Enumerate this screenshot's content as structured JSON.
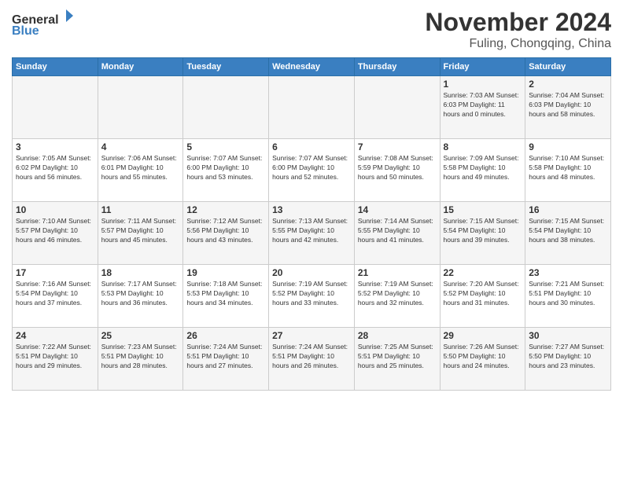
{
  "logo": {
    "general": "General",
    "blue": "Blue"
  },
  "header": {
    "month": "November 2024",
    "location": "Fuling, Chongqing, China"
  },
  "weekdays": [
    "Sunday",
    "Monday",
    "Tuesday",
    "Wednesday",
    "Thursday",
    "Friday",
    "Saturday"
  ],
  "weeks": [
    [
      {
        "day": "",
        "info": ""
      },
      {
        "day": "",
        "info": ""
      },
      {
        "day": "",
        "info": ""
      },
      {
        "day": "",
        "info": ""
      },
      {
        "day": "",
        "info": ""
      },
      {
        "day": "1",
        "info": "Sunrise: 7:03 AM\nSunset: 6:03 PM\nDaylight: 11 hours and 0 minutes."
      },
      {
        "day": "2",
        "info": "Sunrise: 7:04 AM\nSunset: 6:03 PM\nDaylight: 10 hours and 58 minutes."
      }
    ],
    [
      {
        "day": "3",
        "info": "Sunrise: 7:05 AM\nSunset: 6:02 PM\nDaylight: 10 hours and 56 minutes."
      },
      {
        "day": "4",
        "info": "Sunrise: 7:06 AM\nSunset: 6:01 PM\nDaylight: 10 hours and 55 minutes."
      },
      {
        "day": "5",
        "info": "Sunrise: 7:07 AM\nSunset: 6:00 PM\nDaylight: 10 hours and 53 minutes."
      },
      {
        "day": "6",
        "info": "Sunrise: 7:07 AM\nSunset: 6:00 PM\nDaylight: 10 hours and 52 minutes."
      },
      {
        "day": "7",
        "info": "Sunrise: 7:08 AM\nSunset: 5:59 PM\nDaylight: 10 hours and 50 minutes."
      },
      {
        "day": "8",
        "info": "Sunrise: 7:09 AM\nSunset: 5:58 PM\nDaylight: 10 hours and 49 minutes."
      },
      {
        "day": "9",
        "info": "Sunrise: 7:10 AM\nSunset: 5:58 PM\nDaylight: 10 hours and 48 minutes."
      }
    ],
    [
      {
        "day": "10",
        "info": "Sunrise: 7:10 AM\nSunset: 5:57 PM\nDaylight: 10 hours and 46 minutes."
      },
      {
        "day": "11",
        "info": "Sunrise: 7:11 AM\nSunset: 5:57 PM\nDaylight: 10 hours and 45 minutes."
      },
      {
        "day": "12",
        "info": "Sunrise: 7:12 AM\nSunset: 5:56 PM\nDaylight: 10 hours and 43 minutes."
      },
      {
        "day": "13",
        "info": "Sunrise: 7:13 AM\nSunset: 5:55 PM\nDaylight: 10 hours and 42 minutes."
      },
      {
        "day": "14",
        "info": "Sunrise: 7:14 AM\nSunset: 5:55 PM\nDaylight: 10 hours and 41 minutes."
      },
      {
        "day": "15",
        "info": "Sunrise: 7:15 AM\nSunset: 5:54 PM\nDaylight: 10 hours and 39 minutes."
      },
      {
        "day": "16",
        "info": "Sunrise: 7:15 AM\nSunset: 5:54 PM\nDaylight: 10 hours and 38 minutes."
      }
    ],
    [
      {
        "day": "17",
        "info": "Sunrise: 7:16 AM\nSunset: 5:54 PM\nDaylight: 10 hours and 37 minutes."
      },
      {
        "day": "18",
        "info": "Sunrise: 7:17 AM\nSunset: 5:53 PM\nDaylight: 10 hours and 36 minutes."
      },
      {
        "day": "19",
        "info": "Sunrise: 7:18 AM\nSunset: 5:53 PM\nDaylight: 10 hours and 34 minutes."
      },
      {
        "day": "20",
        "info": "Sunrise: 7:19 AM\nSunset: 5:52 PM\nDaylight: 10 hours and 33 minutes."
      },
      {
        "day": "21",
        "info": "Sunrise: 7:19 AM\nSunset: 5:52 PM\nDaylight: 10 hours and 32 minutes."
      },
      {
        "day": "22",
        "info": "Sunrise: 7:20 AM\nSunset: 5:52 PM\nDaylight: 10 hours and 31 minutes."
      },
      {
        "day": "23",
        "info": "Sunrise: 7:21 AM\nSunset: 5:51 PM\nDaylight: 10 hours and 30 minutes."
      }
    ],
    [
      {
        "day": "24",
        "info": "Sunrise: 7:22 AM\nSunset: 5:51 PM\nDaylight: 10 hours and 29 minutes."
      },
      {
        "day": "25",
        "info": "Sunrise: 7:23 AM\nSunset: 5:51 PM\nDaylight: 10 hours and 28 minutes."
      },
      {
        "day": "26",
        "info": "Sunrise: 7:24 AM\nSunset: 5:51 PM\nDaylight: 10 hours and 27 minutes."
      },
      {
        "day": "27",
        "info": "Sunrise: 7:24 AM\nSunset: 5:51 PM\nDaylight: 10 hours and 26 minutes."
      },
      {
        "day": "28",
        "info": "Sunrise: 7:25 AM\nSunset: 5:51 PM\nDaylight: 10 hours and 25 minutes."
      },
      {
        "day": "29",
        "info": "Sunrise: 7:26 AM\nSunset: 5:50 PM\nDaylight: 10 hours and 24 minutes."
      },
      {
        "day": "30",
        "info": "Sunrise: 7:27 AM\nSunset: 5:50 PM\nDaylight: 10 hours and 23 minutes."
      }
    ]
  ]
}
